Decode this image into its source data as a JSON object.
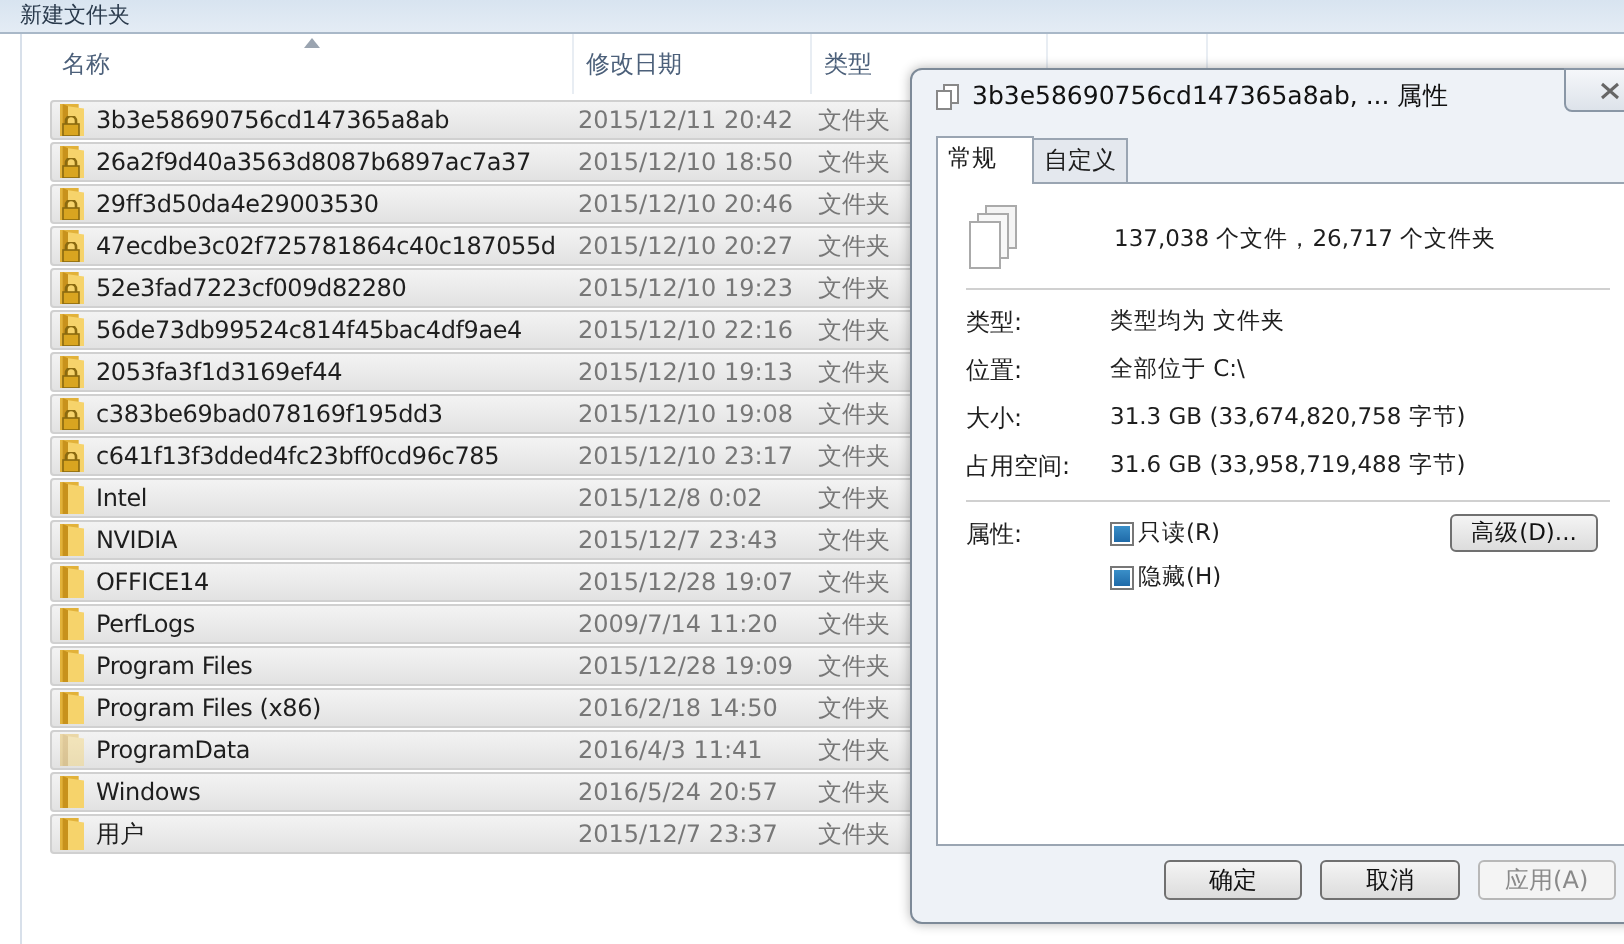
{
  "window": {
    "title": "新建文件夹"
  },
  "columns": [
    {
      "label": "名称",
      "sorted": true
    },
    {
      "label": "修改日期",
      "sorted": false
    },
    {
      "label": "类型",
      "sorted": false
    }
  ],
  "rows": [
    {
      "name": "3b3e58690756cd147365a8ab",
      "date": "2015/12/11 20:42",
      "type": "文件夹",
      "selected": true,
      "locked": true,
      "hidden": false
    },
    {
      "name": "26a2f9d40a3563d8087b6897ac7a37",
      "date": "2015/12/10 18:50",
      "type": "文件夹",
      "selected": true,
      "locked": true,
      "hidden": false
    },
    {
      "name": "29ff3d50da4e29003530",
      "date": "2015/12/10 20:46",
      "type": "文件夹",
      "selected": true,
      "locked": true,
      "hidden": false
    },
    {
      "name": "47ecdbe3c02f725781864c40c187055d",
      "date": "2015/12/10 20:27",
      "type": "文件夹",
      "selected": true,
      "locked": true,
      "hidden": false
    },
    {
      "name": "52e3fad7223cf009d82280",
      "date": "2015/12/10 19:23",
      "type": "文件夹",
      "selected": true,
      "locked": true,
      "hidden": false
    },
    {
      "name": "56de73db99524c814f45bac4df9ae4",
      "date": "2015/12/10 22:16",
      "type": "文件夹",
      "selected": true,
      "locked": true,
      "hidden": false
    },
    {
      "name": "2053fa3f1d3169ef44",
      "date": "2015/12/10 19:13",
      "type": "文件夹",
      "selected": true,
      "locked": true,
      "hidden": false
    },
    {
      "name": "c383be69bad078169f195dd3",
      "date": "2015/12/10 19:08",
      "type": "文件夹",
      "selected": true,
      "locked": true,
      "hidden": false
    },
    {
      "name": "c641f13f3dded4fc23bff0cd96c785",
      "date": "2015/12/10 23:17",
      "type": "文件夹",
      "selected": true,
      "locked": true,
      "hidden": false
    },
    {
      "name": "Intel",
      "date": "2015/12/8 0:02",
      "type": "文件夹",
      "selected": true,
      "locked": false,
      "hidden": false
    },
    {
      "name": "NVIDIA",
      "date": "2015/12/7 23:43",
      "type": "文件夹",
      "selected": true,
      "locked": false,
      "hidden": false
    },
    {
      "name": "OFFICE14",
      "date": "2015/12/28 19:07",
      "type": "文件夹",
      "selected": true,
      "locked": false,
      "hidden": false
    },
    {
      "name": "PerfLogs",
      "date": "2009/7/14 11:20",
      "type": "文件夹",
      "selected": true,
      "locked": false,
      "hidden": false
    },
    {
      "name": "Program Files",
      "date": "2015/12/28 19:09",
      "type": "文件夹",
      "selected": true,
      "locked": false,
      "hidden": false
    },
    {
      "name": "Program Files (x86)",
      "date": "2016/2/18 14:50",
      "type": "文件夹",
      "selected": true,
      "locked": false,
      "hidden": false
    },
    {
      "name": "ProgramData",
      "date": "2016/4/3 11:41",
      "type": "文件夹",
      "selected": true,
      "locked": false,
      "hidden": true
    },
    {
      "name": "Windows",
      "date": "2016/5/24 20:57",
      "type": "文件夹",
      "selected": true,
      "locked": false,
      "hidden": false
    },
    {
      "name": "用户",
      "date": "2015/12/7 23:37",
      "type": "文件夹",
      "selected": true,
      "locked": false,
      "hidden": false
    }
  ],
  "dialog": {
    "title": "3b3e58690756cd147365a8ab, ... 属性",
    "tabs": [
      {
        "label": "常规",
        "selected": true
      },
      {
        "label": "自定义",
        "selected": false
      }
    ],
    "summary": "137,038 个文件，26,717 个文件夹",
    "properties": [
      {
        "label": "类型:",
        "value": "类型均为 文件夹"
      },
      {
        "label": "位置:",
        "value": "全部位于 C:\\"
      },
      {
        "label": "大小:",
        "value": "31.3 GB (33,674,820,758 字节)"
      },
      {
        "label": "占用空间:",
        "value": "31.6 GB (33,958,719,488 字节)"
      }
    ],
    "attributes_label": "属性:",
    "attributes": [
      {
        "label": "只读(R)",
        "indeterminate": true
      },
      {
        "label": "隐藏(H)",
        "indeterminate": true
      }
    ],
    "advanced_button": "高级(D)...",
    "buttons": [
      {
        "label": "确定",
        "disabled": false
      },
      {
        "label": "取消",
        "disabled": false
      },
      {
        "label": "应用(A)",
        "disabled": true
      }
    ]
  }
}
